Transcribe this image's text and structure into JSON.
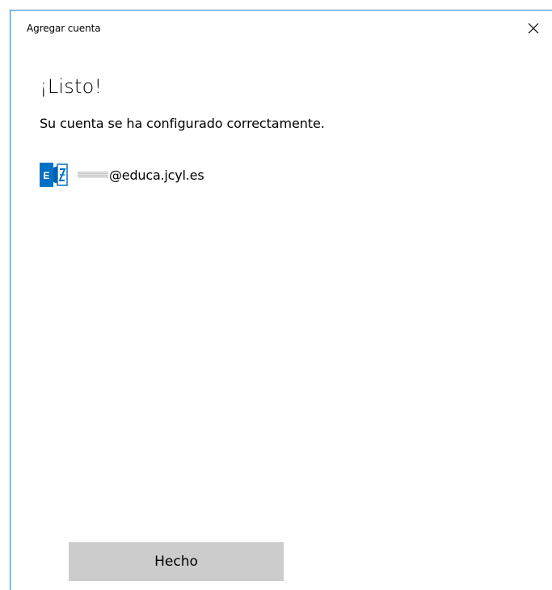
{
  "window": {
    "title": "Agregar cuenta",
    "close_icon": "close-icon"
  },
  "content": {
    "heading": "¡Listo!",
    "message": "Su cuenta se ha configurado correctamente."
  },
  "account": {
    "icon": "exchange-icon",
    "email_suffix": "@educa.jcyl.es",
    "accent_color": "#0072c6"
  },
  "actions": {
    "done_label": "Hecho"
  }
}
